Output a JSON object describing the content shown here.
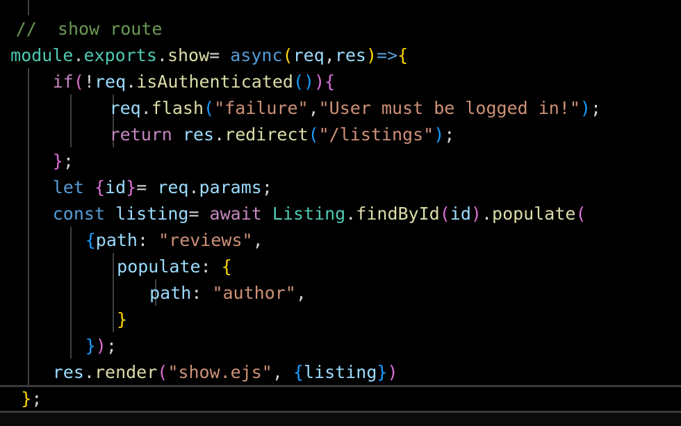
{
  "colors": {
    "background": "#000000",
    "comment": "#6a9955",
    "keyword_control": "#c586c0",
    "keyword_storage": "#569cd6",
    "variable": "#9cdcfe",
    "function": "#dcdcaa",
    "string": "#ce9178",
    "class": "#4ec9b0",
    "bracket1": "#ffd700",
    "bracket2": "#da70d6",
    "bracket3": "#179fff",
    "operator": "#d4d4d4"
  },
  "lines": [
    {
      "indent": 1.5,
      "tokens": [
        {
          "t": "//  show route",
          "c": "comment"
        }
      ]
    },
    {
      "indent": 1,
      "tokens": [
        {
          "t": "module",
          "c": "class"
        },
        {
          "t": ".",
          "c": "operator"
        },
        {
          "t": "exports",
          "c": "class"
        },
        {
          "t": ".",
          "c": "operator"
        },
        {
          "t": "show",
          "c": "function"
        },
        {
          "t": "= ",
          "c": "operator"
        },
        {
          "t": "async",
          "c": "keyword_storage"
        },
        {
          "t": "(",
          "c": "bracket1"
        },
        {
          "t": "req",
          "c": "variable"
        },
        {
          "t": ",",
          "c": "operator"
        },
        {
          "t": "res",
          "c": "variable"
        },
        {
          "t": ")",
          "c": "bracket1"
        },
        {
          "t": "=>",
          "c": "keyword_storage"
        },
        {
          "t": "{",
          "c": "bracket1"
        }
      ]
    },
    {
      "indent": 5,
      "tokens": [
        {
          "t": "if",
          "c": "keyword_control"
        },
        {
          "t": "(",
          "c": "bracket2"
        },
        {
          "t": "!",
          "c": "operator"
        },
        {
          "t": "req",
          "c": "variable"
        },
        {
          "t": ".",
          "c": "operator"
        },
        {
          "t": "isAuthenticated",
          "c": "function"
        },
        {
          "t": "()",
          "c": "bracket3"
        },
        {
          "t": ")",
          "c": "bracket2"
        },
        {
          "t": "{",
          "c": "bracket2"
        }
      ]
    },
    {
      "indent": 10.4,
      "tokens": [
        {
          "t": "req",
          "c": "variable"
        },
        {
          "t": ".",
          "c": "operator"
        },
        {
          "t": "flash",
          "c": "function"
        },
        {
          "t": "(",
          "c": "bracket3"
        },
        {
          "t": "\"failure\"",
          "c": "string"
        },
        {
          "t": ",",
          "c": "operator"
        },
        {
          "t": "\"User must be logged in!\"",
          "c": "string"
        },
        {
          "t": ")",
          "c": "bracket3"
        },
        {
          "t": ";",
          "c": "operator"
        }
      ]
    },
    {
      "indent": 10.4,
      "tokens": [
        {
          "t": "return",
          "c": "keyword_control"
        },
        {
          "t": " ",
          "c": "operator"
        },
        {
          "t": "res",
          "c": "variable"
        },
        {
          "t": ".",
          "c": "operator"
        },
        {
          "t": "redirect",
          "c": "function"
        },
        {
          "t": "(",
          "c": "bracket3"
        },
        {
          "t": "\"/listings\"",
          "c": "string"
        },
        {
          "t": ")",
          "c": "bracket3"
        },
        {
          "t": ";",
          "c": "operator"
        }
      ]
    },
    {
      "indent": 5,
      "tokens": [
        {
          "t": "}",
          "c": "bracket2"
        },
        {
          "t": ";",
          "c": "operator"
        }
      ]
    },
    {
      "indent": 5,
      "tokens": [
        {
          "t": "let",
          "c": "keyword_storage"
        },
        {
          "t": " ",
          "c": "operator"
        },
        {
          "t": "{",
          "c": "bracket2"
        },
        {
          "t": "id",
          "c": "variable"
        },
        {
          "t": "}",
          "c": "bracket2"
        },
        {
          "t": "= ",
          "c": "operator"
        },
        {
          "t": "req",
          "c": "variable"
        },
        {
          "t": ".",
          "c": "operator"
        },
        {
          "t": "params",
          "c": "variable"
        },
        {
          "t": ";",
          "c": "operator"
        }
      ]
    },
    {
      "indent": 5,
      "tokens": [
        {
          "t": "const",
          "c": "keyword_storage"
        },
        {
          "t": " ",
          "c": "operator"
        },
        {
          "t": "listing",
          "c": "variable"
        },
        {
          "t": "= ",
          "c": "operator"
        },
        {
          "t": "await",
          "c": "keyword_control"
        },
        {
          "t": " ",
          "c": "operator"
        },
        {
          "t": "Listing",
          "c": "class"
        },
        {
          "t": ".",
          "c": "operator"
        },
        {
          "t": "findById",
          "c": "function"
        },
        {
          "t": "(",
          "c": "bracket2"
        },
        {
          "t": "id",
          "c": "variable"
        },
        {
          "t": ")",
          "c": "bracket2"
        },
        {
          "t": ".",
          "c": "operator"
        },
        {
          "t": "populate",
          "c": "function"
        },
        {
          "t": "(",
          "c": "bracket2"
        }
      ]
    },
    {
      "indent": 8.1,
      "tokens": [
        {
          "t": "{",
          "c": "bracket3"
        },
        {
          "t": "path",
          "c": "variable"
        },
        {
          "t": ": ",
          "c": "operator"
        },
        {
          "t": "\"reviews\"",
          "c": "string"
        },
        {
          "t": ",",
          "c": "operator"
        }
      ]
    },
    {
      "indent": 11.1,
      "tokens": [
        {
          "t": "populate",
          "c": "variable"
        },
        {
          "t": ": ",
          "c": "operator"
        },
        {
          "t": "{",
          "c": "bracket1"
        }
      ]
    },
    {
      "indent": 14.2,
      "tokens": [
        {
          "t": "path",
          "c": "variable"
        },
        {
          "t": ": ",
          "c": "operator"
        },
        {
          "t": "\"author\"",
          "c": "string"
        },
        {
          "t": ",",
          "c": "operator"
        }
      ]
    },
    {
      "indent": 11.1,
      "tokens": [
        {
          "t": "}",
          "c": "bracket1"
        }
      ]
    },
    {
      "indent": 8.1,
      "tokens": [
        {
          "t": "}",
          "c": "bracket3"
        },
        {
          "t": ")",
          "c": "bracket2"
        },
        {
          "t": ";",
          "c": "operator"
        }
      ]
    },
    {
      "indent": 5,
      "tokens": [
        {
          "t": "res",
          "c": "variable"
        },
        {
          "t": ".",
          "c": "operator"
        },
        {
          "t": "render",
          "c": "function"
        },
        {
          "t": "(",
          "c": "bracket2"
        },
        {
          "t": "\"show.ejs\"",
          "c": "string"
        },
        {
          "t": ", ",
          "c": "operator"
        },
        {
          "t": "{",
          "c": "bracket3"
        },
        {
          "t": "listing",
          "c": "variable"
        },
        {
          "t": "}",
          "c": "bracket3"
        },
        {
          "t": ")",
          "c": "bracket2"
        }
      ]
    },
    {
      "indent": 2,
      "tokens": [
        {
          "t": "}",
          "c": "bracket1"
        },
        {
          "t": ";",
          "c": "operator"
        }
      ]
    }
  ]
}
